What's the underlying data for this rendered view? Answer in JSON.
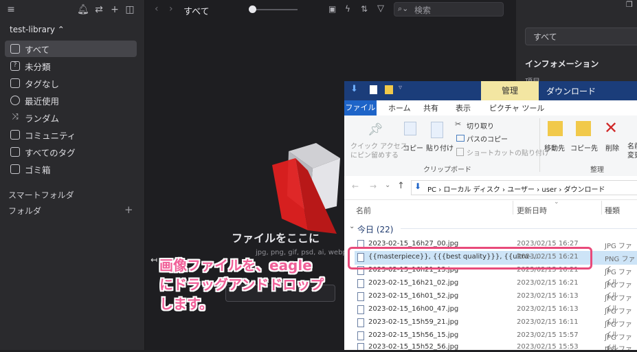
{
  "sidebar": {
    "library_name": "test-library ⌃",
    "items": [
      {
        "label": "すべて",
        "icon": "inbox-icon",
        "active": true
      },
      {
        "label": "未分類",
        "icon": "uncategorized-icon"
      },
      {
        "label": "タグなし",
        "icon": "tag-none-icon"
      },
      {
        "label": "最近使用",
        "icon": "clock-icon"
      },
      {
        "label": "ランダム",
        "icon": "shuffle-icon"
      },
      {
        "label": "コミュニティ",
        "icon": "community-icon"
      },
      {
        "label": "すべてのタグ",
        "icon": "tag-icon"
      },
      {
        "label": "ゴミ箱",
        "icon": "trash-icon"
      }
    ],
    "smart_folders": "スマートフォルダ",
    "folders": "フォルダ",
    "add": "+"
  },
  "topbar": {
    "title": "すべて",
    "search_placeholder": "検索"
  },
  "inspector": {
    "select_value": "すべて",
    "title": "インフォメーション",
    "row_label": "項目"
  },
  "dropzone": {
    "title": "ファイルをここに",
    "subtitle": "jpg, png, gif, psd, ai, webp, r"
  },
  "explorer": {
    "manage_tab": "管理",
    "window_title": "ダウンロード",
    "ribbon_tabs": [
      "ファイル",
      "ホーム",
      "共有",
      "表示",
      "ピクチャ ツール"
    ],
    "ribbon": {
      "quick_access": "クイック アクセス\nにピン留めする",
      "copy": "コピー",
      "paste": "貼り付け",
      "cut": "切り取り",
      "copy_path": "パスのコピー",
      "paste_shortcut": "ショートカットの貼り付け",
      "clipboard_group": "クリップボード",
      "move_to": "移動先",
      "copy_to": "コピー先",
      "delete": "削除",
      "rename": "名前の\n変更",
      "organize_group": "整理"
    },
    "address": "PC  ›  ローカル ディスク  ›  ユーザー  ›  user  ›  ダウンロード",
    "columns": {
      "name": "名前",
      "date": "更新日時",
      "type": "種類"
    },
    "group": "今日 (22)",
    "files": [
      {
        "name": "2023-02-15_16h27_00.jpg",
        "date": "2023/02/15 16:27",
        "type": "JPG ファイル"
      },
      {
        "name": "{{masterpiece}}, {{{best quality}}}, {{ultra-...",
        "date": "2023/02/15 16:21",
        "type": "PNG ファイ",
        "selected": true
      },
      {
        "name": "2023-02-15_16h21_13.jpg",
        "date": "2023/02/15 16:21",
        "type": "JPG ファイル"
      },
      {
        "name": "2023-02-15_16h21_02.jpg",
        "date": "2023/02/15 16:21",
        "type": "JPG ファイル"
      },
      {
        "name": "2023-02-15_16h01_52.jpg",
        "date": "2023/02/15 16:13",
        "type": "JPG ファイル"
      },
      {
        "name": "2023-02-15_16h00_47.jpg",
        "date": "2023/02/15 16:13",
        "type": "JPG ファイル"
      },
      {
        "name": "2023-02-15_15h59_21.jpg",
        "date": "2023/02/15 16:11",
        "type": "JPG ファイル"
      },
      {
        "name": "2023-02-15_15h56_15.jpg",
        "date": "2023/02/15 15:57",
        "type": "JPG ファイル"
      },
      {
        "name": "2023-02-15_15h52_56.jpg",
        "date": "2023/02/15 15:53",
        "type": "JPG ファイル"
      }
    ]
  },
  "annotation": {
    "line1": "画像ファイルを、eagle",
    "line2": "にドラッグアンドドロップ",
    "line3": "します。"
  },
  "colors": {
    "accent_pink": "#e84a7a",
    "explorer_title": "#1b3d7a",
    "selected_row": "#cde4f7"
  }
}
